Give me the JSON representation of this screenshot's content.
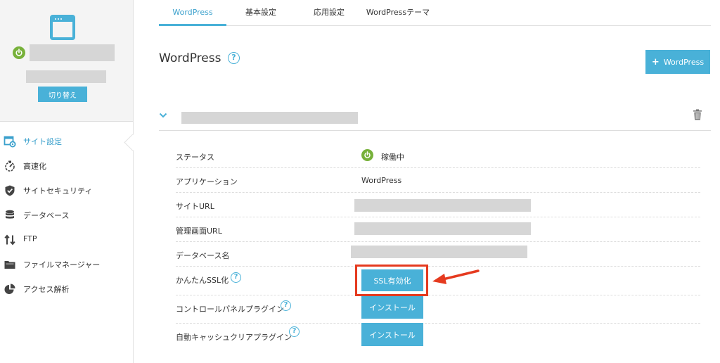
{
  "sidebar": {
    "switch_label": "切り替え",
    "items": [
      {
        "label": "サイト設定",
        "icon": "site-settings-icon",
        "active": true
      },
      {
        "label": "高速化",
        "icon": "speed-icon"
      },
      {
        "label": "サイトセキュリティ",
        "icon": "shield-icon"
      },
      {
        "label": "データベース",
        "icon": "database-icon"
      },
      {
        "label": "FTP",
        "icon": "transfer-icon"
      },
      {
        "label": "ファイルマネージャー",
        "icon": "folder-icon"
      },
      {
        "label": "アクセス解析",
        "icon": "pie-chart-icon"
      }
    ]
  },
  "tabs": [
    {
      "label": "WordPress",
      "active": true
    },
    {
      "label": "基本設定"
    },
    {
      "label": "応用設定"
    },
    {
      "label": "WordPressテーマ"
    }
  ],
  "main": {
    "title": "WordPress",
    "add_button_label": "WordPress",
    "details": {
      "status_label": "ステータス",
      "status_value": "稼働中",
      "application_label": "アプリケーション",
      "application_value": "WordPress",
      "site_url_label": "サイトURL",
      "admin_url_label": "管理画面URL",
      "db_name_label": "データベース名",
      "ssl_label": "かんたんSSL化",
      "ssl_button": "SSL有効化",
      "cp_plugin_label": "コントロールパネルプラグイン",
      "cp_plugin_button": "インストール",
      "cache_plugin_label": "自動キャッシュクリアプラグイン",
      "cache_plugin_button": "インストール"
    }
  },
  "colors": {
    "accent": "#49b1d8",
    "status_green": "#77b13a",
    "highlight_red": "#e53a1f"
  }
}
